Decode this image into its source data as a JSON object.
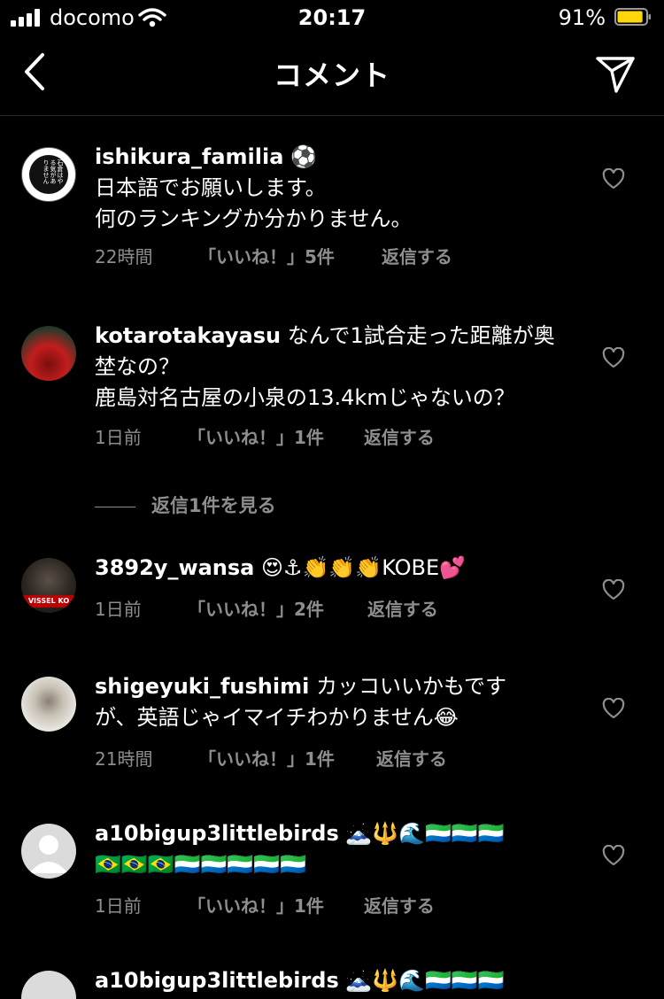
{
  "status_bar": {
    "carrier": "docomo",
    "time": "20:17",
    "battery": "91%",
    "battery_level": 0.91
  },
  "nav": {
    "title": "コメント"
  },
  "comments": [
    {
      "username": "ishikura_familia",
      "username_suffix": " ⚽",
      "text": "日本語でお願いします。\n何のランキングか分かりません。",
      "time": "22時間",
      "likes": "「いいね！」5件",
      "reply": "返信する"
    },
    {
      "username": "kotarotakayasu",
      "text": " なんで1試合走った距離が奥埜なの？\n鹿島対名古屋の小泉の13.4kmじゃないの？",
      "time": "1日前",
      "likes": "「いいね！」1件",
      "reply": "返信する"
    },
    {
      "username": "3892y_wansa",
      "text": " 😍⚓👏👏👏KOBE💕",
      "time": "1日前",
      "likes": "「いいね！」2件",
      "reply": "返信する"
    },
    {
      "username": "shigeyuki_fushimi",
      "text": " カッコいいかもです\nが、英語じゃイマイチわかりません😂",
      "time": "21時間",
      "likes": "「いいね！」1件",
      "reply": "返信する"
    },
    {
      "username": "a10bigup3littlebirds",
      "text": " 🗻🔱🌊🇸🇱🇸🇱🇸🇱\n🇧🇷🇧🇷🇧🇷🇸🇱🇸🇱🇸🇱🇸🇱🇸🇱",
      "time": "1日前",
      "likes": "「いいね！」1件",
      "reply": "返信する"
    },
    {
      "username": "a10bigup3littlebirds",
      "text": " 🗻🔱🌊🇸🇱🇸🇱🇸🇱"
    }
  ],
  "view_replies": "返信1件を見る",
  "avatar_text": {
    "c0": "石倉はやる気がありません",
    "c2": "VISSEL KO"
  }
}
